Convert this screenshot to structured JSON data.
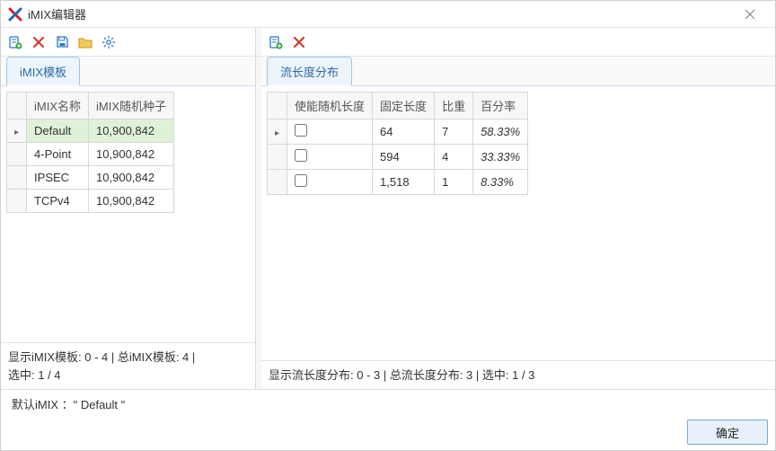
{
  "window": {
    "title": "iMIX编辑器"
  },
  "left": {
    "tab_label": "iMIX模板",
    "columns": {
      "name": "iMIX名称",
      "seed": "iMIX随机种子"
    },
    "rows": [
      {
        "name": "Default",
        "seed": "10,900,842",
        "selected": true
      },
      {
        "name": "4-Point",
        "seed": "10,900,842",
        "selected": false
      },
      {
        "name": "IPSEC",
        "seed": "10,900,842",
        "selected": false
      },
      {
        "name": "TCPv4",
        "seed": "10,900,842",
        "selected": false
      }
    ],
    "status_line1": "显示iMIX模板:   0 - 4 | 总iMIX模板: 4 |",
    "status_line2": "选中: 1 / 4"
  },
  "right": {
    "tab_label": "流长度分布",
    "columns": {
      "random": "使能随机长度",
      "fixed": "固定长度",
      "weight": "比重",
      "percent": "百分率"
    },
    "rows": [
      {
        "random": false,
        "fixed": "64",
        "weight": "7",
        "percent": "58.33%",
        "selected": true
      },
      {
        "random": false,
        "fixed": "594",
        "weight": "4",
        "percent": "33.33%",
        "selected": false
      },
      {
        "random": false,
        "fixed": "1,518",
        "weight": "1",
        "percent": "8.33%",
        "selected": false
      }
    ],
    "status": "显示流长度分布:   0 - 3 | 总流长度分布: 3 | 选中: 1 / 3"
  },
  "footer": {
    "default_label": "默认iMIX  ：\" Default \"",
    "ok_label": "确定"
  }
}
